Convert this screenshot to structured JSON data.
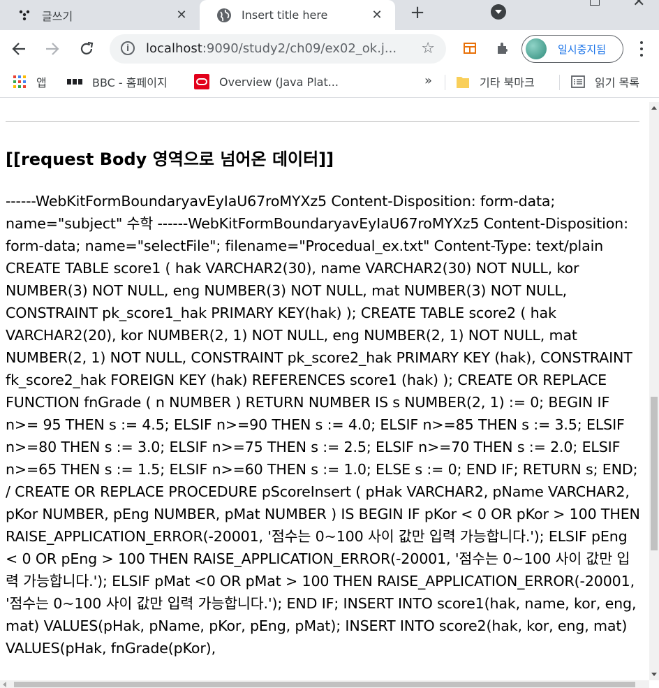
{
  "browser": {
    "tabs": [
      {
        "title": "글쓰기",
        "active": false,
        "icon": "dots-icon"
      },
      {
        "title": "Insert title here",
        "active": true,
        "icon": "globe-icon"
      }
    ],
    "address": {
      "url_host": "localhost",
      "url_rest": ":9090/study2/ch09/ex02_ok.j..."
    },
    "profile_label": "일시중지됨",
    "bookmarks": [
      {
        "label": "앱",
        "icon": "apps-grid-icon"
      },
      {
        "label": "BBC - 홈페이지",
        "icon": "bbc-icon"
      },
      {
        "label": "Overview (Java Plat...",
        "icon": "oracle-icon"
      }
    ],
    "bookmarks_more": "»",
    "other_bookmarks": "기타 북마크",
    "reading_list": "읽기 목록"
  },
  "page": {
    "heading": "[[request Body 영역으로 넘어온 데이터]]",
    "body": "------WebKitFormBoundaryavEyIaU67roMYXz5 Content-Disposition: form-data; name=\"subject\" 수학 ------WebKitFormBoundaryavEyIaU67roMYXz5 Content-Disposition: form-data; name=\"selectFile\"; filename=\"Procedual_ex.txt\" Content-Type: text/plain CREATE TABLE score1 ( hak VARCHAR2(30), name VARCHAR2(30) NOT NULL, kor NUMBER(3) NOT NULL, eng NUMBER(3) NOT NULL, mat NUMBER(3) NOT NULL, CONSTRAINT pk_score1_hak PRIMARY KEY(hak) ); CREATE TABLE score2 ( hak VARCHAR2(20), kor NUMBER(2, 1) NOT NULL, eng NUMBER(2, 1) NOT NULL, mat NUMBER(2, 1) NOT NULL, CONSTRAINT pk_score2_hak PRIMARY KEY (hak), CONSTRAINT fk_score2_hak FOREIGN KEY (hak) REFERENCES score1 (hak) ); CREATE OR REPLACE FUNCTION fnGrade ( n NUMBER ) RETURN NUMBER IS s NUMBER(2, 1) := 0; BEGIN IF n>= 95 THEN s := 4.5; ELSIF n>=90 THEN s := 4.0; ELSIF n>=85 THEN s := 3.5; ELSIF n>=80 THEN s := 3.0; ELSIF n>=75 THEN s := 2.5; ELSIF n>=70 THEN s := 2.0; ELSIF n>=65 THEN s := 1.5; ELSIF n>=60 THEN s := 1.0; ELSE s := 0; END IF; RETURN s; END; / CREATE OR REPLACE PROCEDURE pScoreInsert ( pHak VARCHAR2, pName VARCHAR2, pKor NUMBER, pEng NUMBER, pMat NUMBER ) IS BEGIN IF pKor < 0 OR pKor > 100 THEN RAISE_APPLICATION_ERROR(-20001, '점수는 0~100 사이 값만 입력 가능합니다.'); ELSIF pEng < 0 OR pEng > 100 THEN RAISE_APPLICATION_ERROR(-20001, '점수는 0~100 사이 값만 입력 가능합니다.'); ELSIF pMat <0 OR pMat > 100 THEN RAISE_APPLICATION_ERROR(-20001, '점수는 0~100 사이 값만 입력 가능합니다.'); END IF; INSERT INTO score1(hak, name, kor, eng, mat) VALUES(pHak, pName, pKor, pEng, pMat); INSERT INTO score2(hak, kor, eng, mat) VALUES(pHak, fnGrade(pKor),"
  }
}
